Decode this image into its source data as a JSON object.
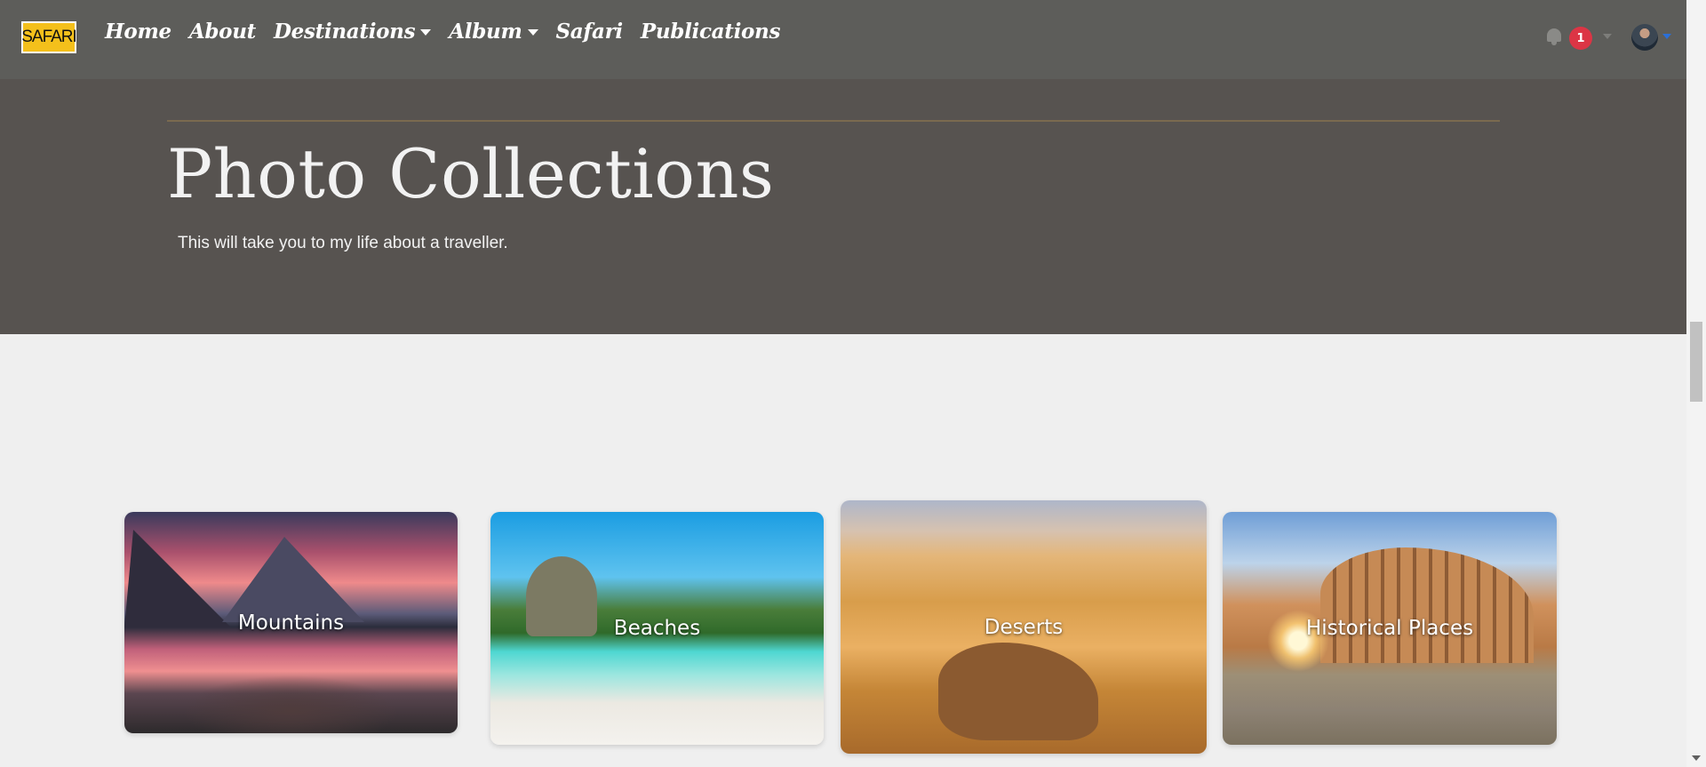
{
  "navbar": {
    "logo_text": "SAFARI",
    "links": [
      {
        "label": "Home"
      },
      {
        "label": "About"
      },
      {
        "label": "Destinations"
      },
      {
        "label": "Album"
      },
      {
        "label": "Safari"
      },
      {
        "label": "Publications"
      }
    ],
    "notification_count": "1",
    "bell_icon": "bell-icon",
    "avatar_icon": "user-avatar"
  },
  "hero": {
    "title": "Photo Collections",
    "subtitle": "This will take you to my life about a traveller."
  },
  "cards": [
    {
      "label": "Mountains"
    },
    {
      "label": "Beaches"
    },
    {
      "label": "Deserts"
    },
    {
      "label": "Historical Places"
    }
  ],
  "colors": {
    "navbar_bg": "#5d5d5a",
    "hero_bg": "#575350",
    "page_bg": "#efefef",
    "badge": "#dc3545",
    "logo_bg": "#f4c01b"
  }
}
